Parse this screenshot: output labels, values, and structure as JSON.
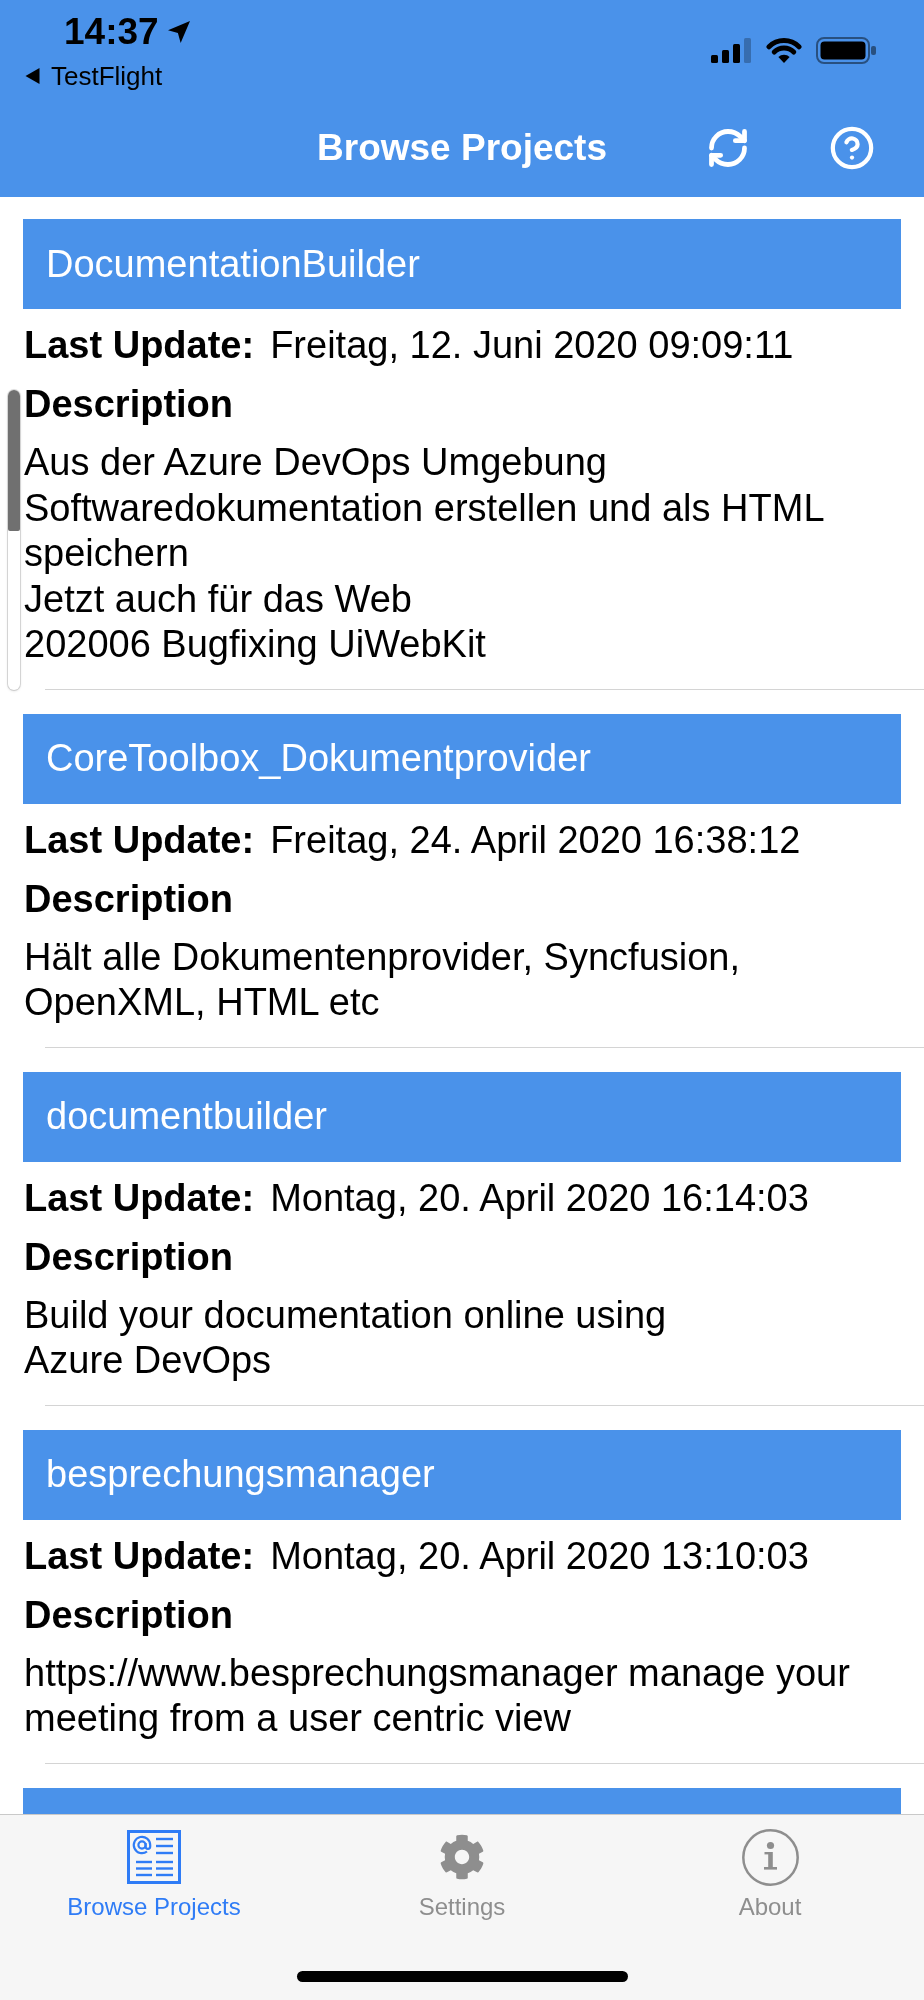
{
  "status_bar": {
    "time": "14:37",
    "back_label": "TestFlight"
  },
  "nav_bar": {
    "title": "Browse Projects"
  },
  "projects": {
    "items": [
      {
        "title": "DocumentationBuilder",
        "update_label": "Last Update:",
        "last_update": "Freitag, 12. Juni 2020 09:09:11",
        "description_label": "Description",
        "description": "Aus der Azure DevOps Umgebung\nSoftwaredokumentation erstellen und als HTML\nspeichern\nJetzt auch für das Web\n202006 Bugfixing UiWebKit"
      },
      {
        "title": "CoreToolbox_Dokumentprovider",
        "update_label": "Last Update:",
        "last_update": "Freitag, 24. April 2020 16:38:12",
        "description_label": "Description",
        "description": "Hält alle Dokumentenprovider, Syncfusion,\nOpenXML, HTML etc"
      },
      {
        "title": "documentbuilder",
        "update_label": "Last Update:",
        "last_update": "Montag, 20. April 2020 16:14:03",
        "description_label": "Description",
        "description": "Build your documentation online using\nAzure DevOps"
      },
      {
        "title": "besprechungsmanager",
        "update_label": "Last Update:",
        "last_update": "Montag, 20. April 2020 13:10:03",
        "description_label": "Description",
        "description": "https://www.besprechungsmanager manage your\nmeeting from a user centric view"
      }
    ],
    "more_below": true
  },
  "tabs": [
    {
      "label": "Browse Projects",
      "selected": true
    },
    {
      "label": "Settings",
      "selected": false
    },
    {
      "label": "About",
      "selected": false
    }
  ]
}
